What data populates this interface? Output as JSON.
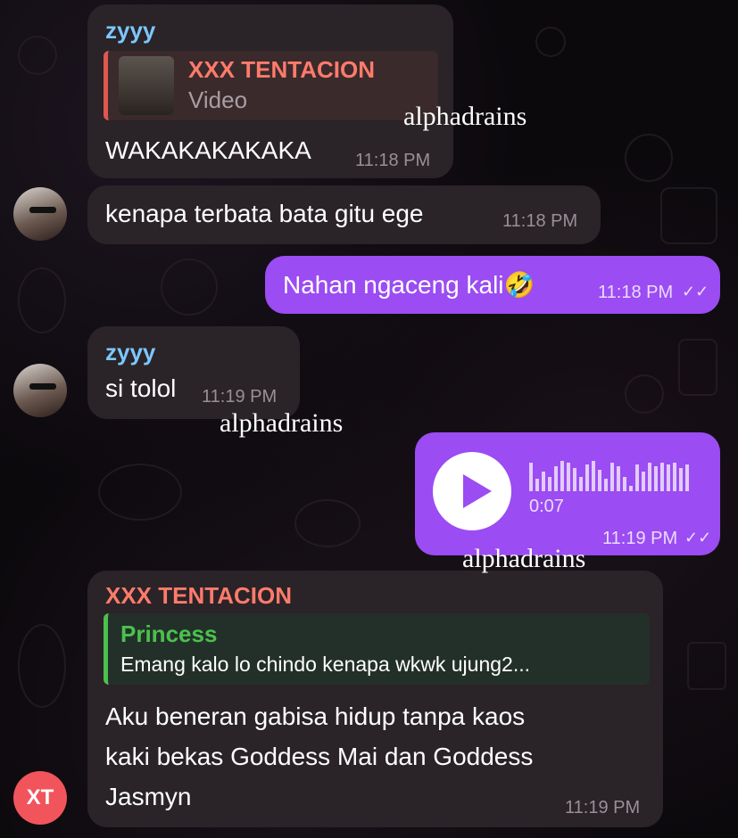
{
  "colors": {
    "incoming": "#2a2327",
    "outgoing": "#9b4cf2",
    "zyyy": "#7cc7ff",
    "xxx": "#ff7b6b",
    "princess": "#4cc14c"
  },
  "watermark": "alphadrains",
  "msg1": {
    "sender": "zyyy",
    "reply_name": "XXX TENTACION",
    "reply_type": "Video",
    "text": "WAKAKAKAKAKA",
    "time": "11:18 PM"
  },
  "msg2": {
    "text": "kenapa terbata bata gitu ege",
    "time": "11:18 PM"
  },
  "msg3": {
    "text": "Nahan ngaceng kali",
    "emoji": "🤣",
    "time": "11:18 PM",
    "status": "read"
  },
  "msg4": {
    "sender": "zyyy",
    "text": "si tolol",
    "time": "11:19 PM"
  },
  "msg5": {
    "duration": "0:07",
    "time": "11:19 PM",
    "status": "read",
    "icon": "play-icon"
  },
  "msg6": {
    "sender": "XXX TENTACION",
    "reply_name": "Princess",
    "reply_text": "Emang kalo lo chindo kenapa wkwk ujung2...",
    "text_lines": [
      "Aku beneran gabisa hidup tanpa kaos",
      "kaki bekas Goddess Mai dan Goddess",
      "Jasmyn"
    ],
    "time": "11:19 PM",
    "avatar_initials": "XT"
  }
}
